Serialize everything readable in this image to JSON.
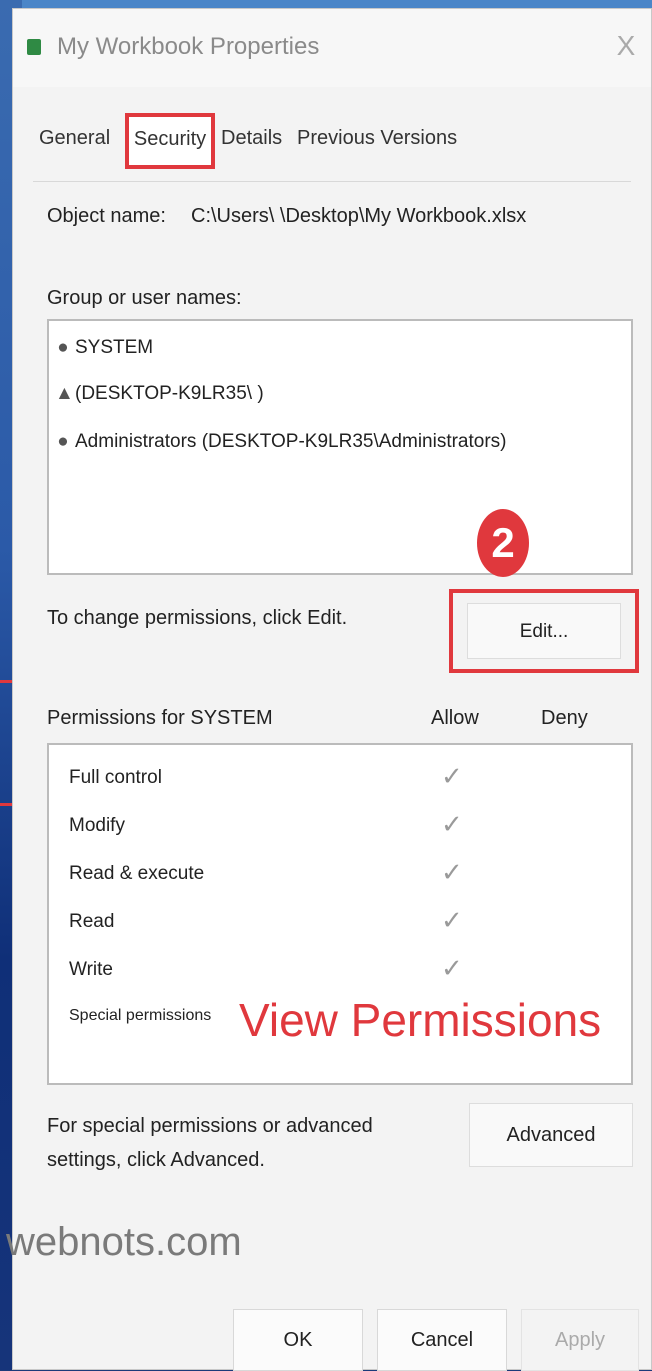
{
  "window": {
    "title": "My Workbook Properties",
    "close_symbol": "X"
  },
  "tabs": [
    {
      "label": "General"
    },
    {
      "label": "Security"
    },
    {
      "label": "Details"
    },
    {
      "label": "Previous Versions"
    }
  ],
  "object": {
    "label": "Object name:",
    "value": "C:\\Users\\      \\Desktop\\My Workbook.xlsx"
  },
  "users": {
    "label": "Group or user names:",
    "items": [
      {
        "name": "SYSTEM",
        "icon": "users-group-icon"
      },
      {
        "name": "(DESKTOP-K9LR35\\    )",
        "icon": "user-icon"
      },
      {
        "name": "Administrators (DESKTOP-K9LR35\\Administrators)",
        "icon": "users-group-icon"
      }
    ]
  },
  "annotation": {
    "step_number": "2",
    "overlay_text": "View Permissions",
    "watermark": "webnots.com",
    "accent_color": "#e0383d"
  },
  "change": {
    "label": "To change permissions, click Edit.",
    "edit_button": "Edit..."
  },
  "permissions": {
    "label": "Permissions for SYSTEM",
    "allow_header": "Allow",
    "deny_header": "Deny",
    "rows": [
      {
        "name": "Full control",
        "allow": true,
        "deny": false
      },
      {
        "name": "Modify",
        "allow": true,
        "deny": false
      },
      {
        "name": "Read & execute",
        "allow": true,
        "deny": false
      },
      {
        "name": "Read",
        "allow": true,
        "deny": false
      },
      {
        "name": "Write",
        "allow": true,
        "deny": false
      },
      {
        "name": "Special permissions",
        "allow": false,
        "deny": false
      }
    ]
  },
  "advanced": {
    "label": "For special permissions or advanced settings, click Advanced.",
    "button": "Advanced"
  },
  "footer": {
    "ok": "OK",
    "cancel": "Cancel",
    "apply": "Apply"
  }
}
